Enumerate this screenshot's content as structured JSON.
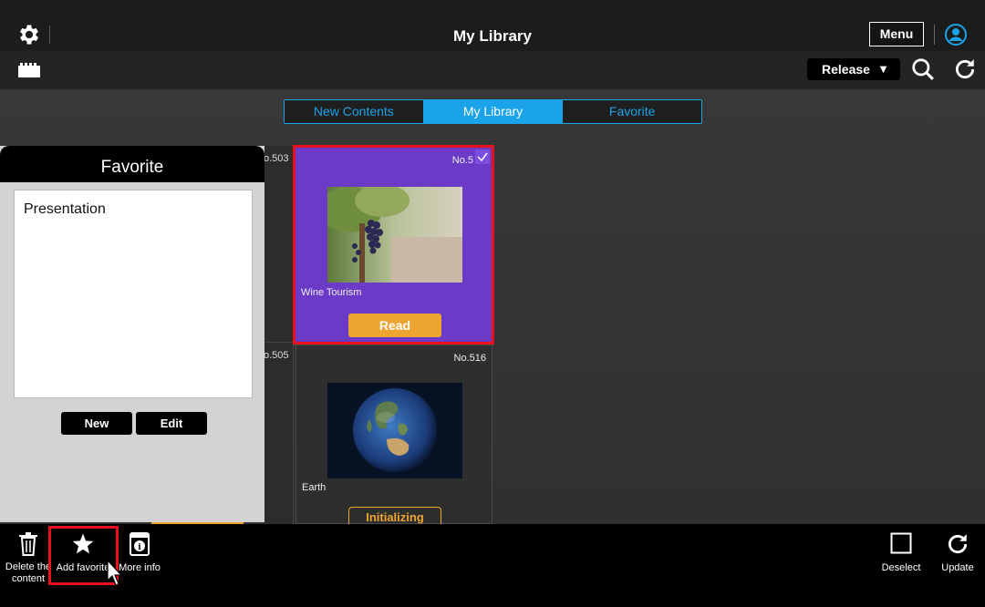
{
  "header": {
    "title": "My Library",
    "menu_label": "Menu"
  },
  "toolbar": {
    "release_label": "Release",
    "release_arrow": "▼"
  },
  "tabs": [
    {
      "label": "New Contents",
      "active": false
    },
    {
      "label": "My Library",
      "active": true
    },
    {
      "label": "Favorite",
      "active": false
    }
  ],
  "cards": [
    {
      "number": "No.5",
      "title": "Wine Tourism",
      "action": "Read",
      "selected": true
    },
    {
      "number": "No.516",
      "title": "Earth",
      "action": "Initializing",
      "selected": false
    }
  ],
  "partial_numbers": [
    "o.503",
    "o.505"
  ],
  "favorite_panel": {
    "title": "Favorite",
    "items": [
      "Presentation"
    ],
    "new_label": "New",
    "edit_label": "Edit"
  },
  "bottom_bar": {
    "delete_label_line1": "Delete the",
    "delete_label_line2": "content",
    "add_favorite_label": "Add favorite",
    "more_info_label": "More info",
    "deselect_label": "Deselect",
    "update_label": "Update"
  },
  "colors": {
    "accent": "#1aa3e8",
    "selected_card": "#6b3bc7",
    "action_button": "#eea430",
    "highlight": "#e8111b"
  },
  "icons": [
    "gear-icon",
    "user-icon",
    "film-icon",
    "search-icon",
    "refresh-icon",
    "trash-icon",
    "star-icon",
    "info-icon",
    "deselect-icon",
    "update-icon",
    "check-icon",
    "cursor-icon"
  ]
}
